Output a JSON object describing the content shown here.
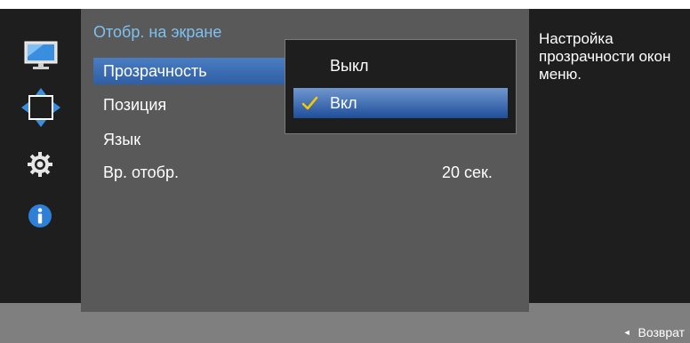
{
  "menu": {
    "title": "Отобр. на экране",
    "items": [
      {
        "label": "Прозрачность",
        "value": ""
      },
      {
        "label": "Позиция",
        "value": ""
      },
      {
        "label": "Язык",
        "value": ""
      },
      {
        "label": "Вр. отобр.",
        "value": "20 сек."
      }
    ]
  },
  "dropdown": {
    "options": [
      {
        "label": "Выкл",
        "checked": false
      },
      {
        "label": "Вкл",
        "checked": true
      }
    ]
  },
  "help": {
    "text": "Настройка прозрачности окон меню."
  },
  "footer": {
    "return_label": "Возврат"
  },
  "sidebar_icons": [
    "monitor-icon",
    "move-arrows-icon",
    "gear-icon",
    "info-icon"
  ],
  "colors": {
    "title": "#7ec1ef",
    "selection": "#2f5fa4",
    "check": "#f5c800",
    "panel": "#595959",
    "sidebar": "#1e1e1e"
  }
}
